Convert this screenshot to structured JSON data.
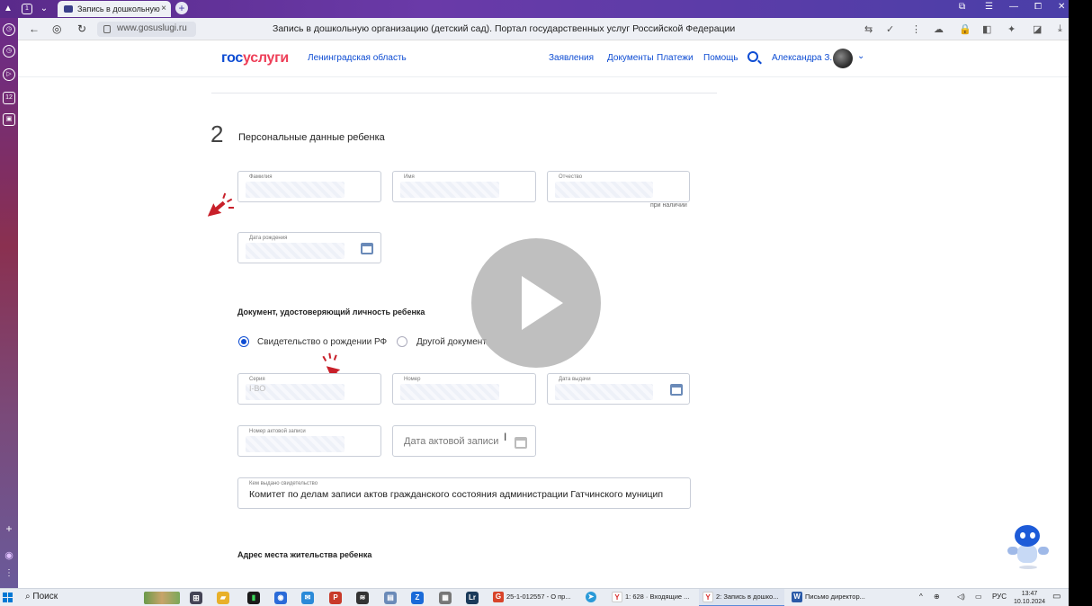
{
  "browser": {
    "tab_title": "Запись в дошкольную",
    "tab_close": "×",
    "new_tab": "+",
    "url": "www.gosuslugi.ru",
    "page_title": "Запись в дошкольную организацию (детский сад). Портал государственных услуг Российской Федерации",
    "window_controls": [
      "⧉",
      "☰",
      "—",
      "⧠",
      "✕"
    ],
    "nav": {
      "back": "←",
      "forward_icon": "◎",
      "reload": "↻"
    },
    "toolbar_icons": [
      "⇆",
      "✓",
      "⋮",
      "☁",
      "🔒",
      "◧",
      "✦",
      "◪",
      "⤓"
    ]
  },
  "left_sidebar": {
    "icons": [
      "◷",
      "◷",
      "▷",
      "12",
      "▣"
    ],
    "bottom_icons": [
      "+",
      "◉",
      "⋮"
    ]
  },
  "site": {
    "logo_part1": "гос",
    "logo_part2": "услуги",
    "region": "Ленинградская область",
    "menu": [
      "Заявления",
      "Документы",
      "Платежи",
      "Помощь"
    ],
    "user_name": "Александра З.",
    "chevron": "⌄"
  },
  "form": {
    "step_number": "2",
    "section_title": "Персональные данные ребенка",
    "fields": {
      "surname_label": "Фамилия",
      "name_label": "Имя",
      "patronymic_label": "Отчество",
      "patronymic_hint": "при наличии",
      "birthdate_label": "Дата рождения"
    },
    "document_heading": "Документ, удостоверяющий личность ребенка",
    "radio_options": [
      "Свидетельство о рождении РФ",
      "Другой документ"
    ],
    "doc_fields": {
      "series_label": "Серия",
      "series_value": "I-ВО",
      "number_label": "Номер",
      "issue_date_label": "Дата выдачи",
      "record_number_label": "Номер актовой записи",
      "record_date_placeholder": "Дата актовой записи",
      "issued_by_label": "Кем выдано свидетельство",
      "issued_by_value": "Комитет по делам записи актов гражданского состояния администрации Гатчинского муницип"
    },
    "address_heading": "Адрес места жительства ребенка",
    "text_cursor": "I"
  },
  "taskbar": {
    "search_label": "Поиск",
    "apps": [
      {
        "icon": "E",
        "color": "#2a7a3a"
      },
      {
        "icon": "C",
        "color": "#2a6ad8"
      },
      {
        "icon": "W",
        "color": "#2a5aa8"
      },
      {
        "icon": "P",
        "color": "#c83a2a"
      },
      {
        "icon": "Z",
        "color": "#1a6ad8"
      },
      {
        "icon": "Lr",
        "color": "#1a3a5a"
      }
    ],
    "items": [
      {
        "label": "25-1-012557 - О пр...",
        "icon": "G",
        "color": "#d8442a"
      },
      {
        "label": "",
        "icon": "➤",
        "color": "#2a9ad8"
      },
      {
        "label": "1: 628 · Входящие ...",
        "icon": "Y",
        "color": "#d82a2a"
      },
      {
        "label": "2: Запись в дошко...",
        "icon": "Y",
        "color": "#d82a2a"
      },
      {
        "label": "Письмо директор...",
        "icon": "W",
        "color": "#2a5aa8"
      }
    ],
    "tray_lang": "РУС",
    "time": "13:47",
    "date": "10.10.2024",
    "tray_icons": [
      "^",
      "⊕",
      "◁)",
      "▭"
    ]
  }
}
